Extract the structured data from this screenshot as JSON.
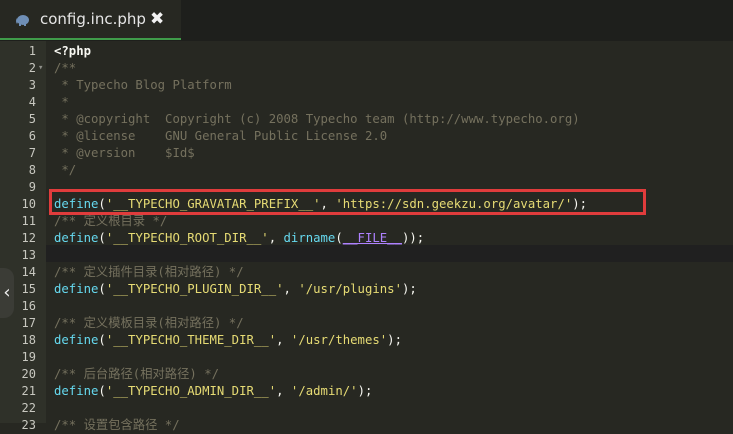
{
  "tab": {
    "title": "config.inc.php",
    "icon": "php-elephant-icon",
    "close": "✖"
  },
  "gutter": {
    "numbers": [
      "1",
      "2",
      "3",
      "4",
      "5",
      "6",
      "7",
      "8",
      "9",
      "10",
      "11",
      "12",
      "13",
      "14",
      "15",
      "16",
      "17",
      "18",
      "19",
      "20",
      "21",
      "22",
      "23"
    ],
    "fold_marks": [
      "",
      "▾",
      "",
      "",
      "",
      "",
      "",
      "",
      "",
      "",
      "",
      "",
      "",
      "",
      "",
      "",
      "",
      "",
      "",
      "",
      "",
      "",
      ""
    ]
  },
  "code_lines": [
    [
      {
        "t": "<?php",
        "c": "php"
      }
    ],
    [
      {
        "t": "/**",
        "c": "comment"
      }
    ],
    [
      {
        "t": " * Typecho Blog Platform",
        "c": "comment"
      }
    ],
    [
      {
        "t": " *",
        "c": "comment"
      }
    ],
    [
      {
        "t": " * @copyright  Copyright (c) 2008 Typecho team (http://www.typecho.org)",
        "c": "comment"
      }
    ],
    [
      {
        "t": " * @license    GNU General Public License 2.0",
        "c": "comment"
      }
    ],
    [
      {
        "t": " * @version    $Id$",
        "c": "comment"
      }
    ],
    [
      {
        "t": " */",
        "c": "comment"
      }
    ],
    [],
    [
      {
        "t": "define",
        "c": "kw"
      },
      {
        "t": "(",
        "c": ""
      },
      {
        "t": "'__TYPECHO_GRAVATAR_PREFIX__'",
        "c": "str"
      },
      {
        "t": ", ",
        "c": ""
      },
      {
        "t": "'https://sdn.geekzu.org/avatar/'",
        "c": "str"
      },
      {
        "t": ");",
        "c": ""
      }
    ],
    [
      {
        "t": "/** 定义根目录 */",
        "c": "comment"
      }
    ],
    [
      {
        "t": "define",
        "c": "kw"
      },
      {
        "t": "(",
        "c": ""
      },
      {
        "t": "'__TYPECHO_ROOT_DIR__'",
        "c": "str"
      },
      {
        "t": ", ",
        "c": ""
      },
      {
        "t": "dirname",
        "c": "kw"
      },
      {
        "t": "(",
        "c": ""
      },
      {
        "t": "__FILE__",
        "c": "const"
      },
      {
        "t": "));",
        "c": ""
      }
    ],
    [],
    [
      {
        "t": "/** 定义插件目录(相对路径) */",
        "c": "comment"
      }
    ],
    [
      {
        "t": "define",
        "c": "kw"
      },
      {
        "t": "(",
        "c": ""
      },
      {
        "t": "'__TYPECHO_PLUGIN_DIR__'",
        "c": "str"
      },
      {
        "t": ", ",
        "c": ""
      },
      {
        "t": "'/usr/plugins'",
        "c": "str"
      },
      {
        "t": ");",
        "c": ""
      }
    ],
    [],
    [
      {
        "t": "/** 定义模板目录(相对路径) */",
        "c": "comment"
      }
    ],
    [
      {
        "t": "define",
        "c": "kw"
      },
      {
        "t": "(",
        "c": ""
      },
      {
        "t": "'__TYPECHO_THEME_DIR__'",
        "c": "str"
      },
      {
        "t": ", ",
        "c": ""
      },
      {
        "t": "'/usr/themes'",
        "c": "str"
      },
      {
        "t": ");",
        "c": ""
      }
    ],
    [],
    [
      {
        "t": "/** 后台路径(相对路径) */",
        "c": "comment"
      }
    ],
    [
      {
        "t": "define",
        "c": "kw"
      },
      {
        "t": "(",
        "c": ""
      },
      {
        "t": "'__TYPECHO_ADMIN_DIR__'",
        "c": "str"
      },
      {
        "t": ", ",
        "c": ""
      },
      {
        "t": "'/admin/'",
        "c": "str"
      },
      {
        "t": ");",
        "c": ""
      }
    ],
    [],
    [
      {
        "t": "/** 设置包含路径 */",
        "c": "comment"
      }
    ]
  ],
  "side_arrow": "‹"
}
